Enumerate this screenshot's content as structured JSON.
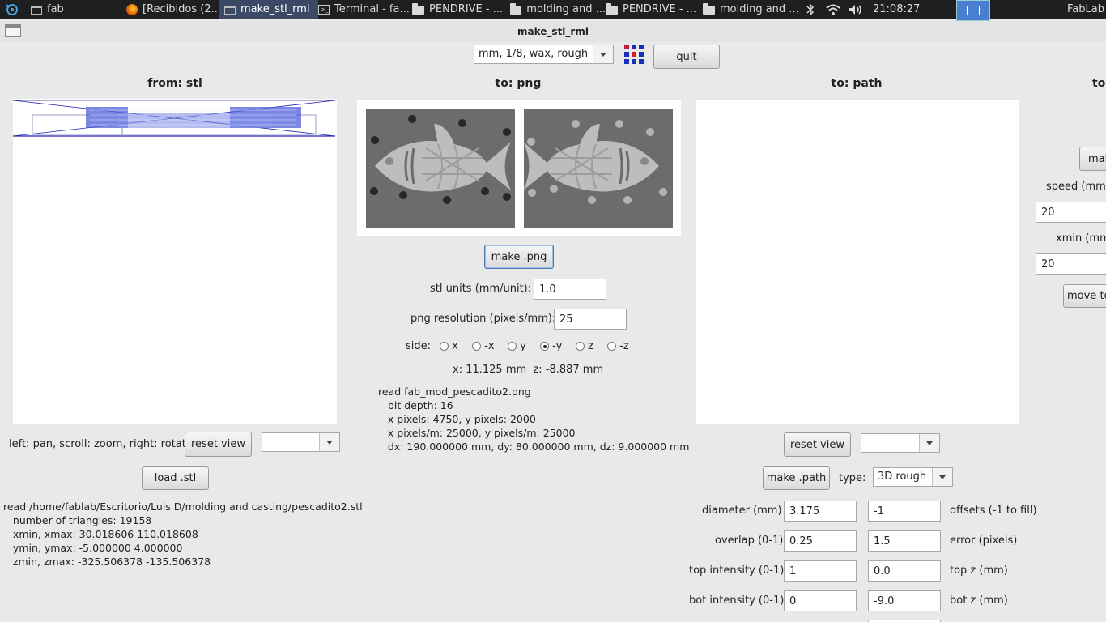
{
  "taskbar": {
    "items": [
      {
        "label": "fab",
        "icon": "window-icon"
      },
      {
        "label": "[Recibidos (2...",
        "icon": "firefox-icon"
      },
      {
        "label": "make_stl_rml",
        "icon": "window-icon"
      },
      {
        "label": "Terminal - fa...",
        "icon": "terminal-icon"
      },
      {
        "label": "PENDRIVE - ...",
        "icon": "folder-icon"
      },
      {
        "label": "molding and ...",
        "icon": "folder-icon"
      },
      {
        "label": "PENDRIVE - ...",
        "icon": "folder-icon"
      },
      {
        "label": "molding and ...",
        "icon": "folder-icon"
      }
    ],
    "clock": "21:08:27",
    "user": "FabLab"
  },
  "window": {
    "title": "make_stl_rml"
  },
  "toolbar": {
    "process": "mm, 1/8, wax, rough",
    "quit_label": "quit"
  },
  "stl": {
    "header": "from: stl",
    "hint": "left: pan, scroll: zoom, right: rotate",
    "reset_label": "reset view",
    "load_label": "load .stl",
    "info": [
      "read /home/fablab/Escritorio/Luis D/molding and casting/pescadito2.stl",
      "   number of triangles: 19158",
      "   xmin, xmax: 30.018606 110.018608",
      "   ymin, ymax: -5.000000 4.000000",
      "   zmin, zmax: -325.506378 -135.506378"
    ]
  },
  "png": {
    "header": "to: png",
    "make_label": "make .png",
    "units_label": "stl units (mm/unit):",
    "units_value": "1.0",
    "res_label": "png resolution (pixels/mm):",
    "res_value": "25",
    "side_label": "side:",
    "sides": [
      "x",
      "-x",
      "y",
      "-y",
      "z",
      "-z"
    ],
    "side_selected": "-y",
    "coords": "x: 11.125 mm  z: -8.887 mm",
    "info": [
      "read fab_mod_pescadito2.png",
      "   bit depth: 16",
      "   x pixels: 4750, y pixels: 2000",
      "   x pixels/m: 25000, y pixels/m: 25000",
      "   dx: 190.000000 mm, dy: 80.000000 mm, dz: 9.000000 mm"
    ]
  },
  "path": {
    "header": "to: path",
    "reset_label": "reset view",
    "make_label": "make .path",
    "type_label": "type:",
    "type_value": "3D rough",
    "rows": [
      {
        "left_label": "diameter (mm)",
        "left_value": "3.175",
        "right_value": "-1",
        "right_label": "offsets (-1 to fill)"
      },
      {
        "left_label": "overlap (0-1)",
        "left_value": "0.25",
        "right_value": "1.5",
        "right_label": "error (pixels)"
      },
      {
        "left_label": "top intensity (0-1)",
        "left_value": "1",
        "right_value": "0.0",
        "right_label": "top z (mm)"
      },
      {
        "left_label": "bot intensity (0-1)",
        "left_value": "0",
        "right_value": "-9.0",
        "right_label": "bot z (mm)"
      }
    ]
  },
  "rml": {
    "header": "to:",
    "make_label": "mak",
    "speed_label": "speed (mm/s",
    "speed_value": "20",
    "xmin_label": "xmin (mm",
    "xmin_value": "20",
    "move_label": "move to"
  }
}
